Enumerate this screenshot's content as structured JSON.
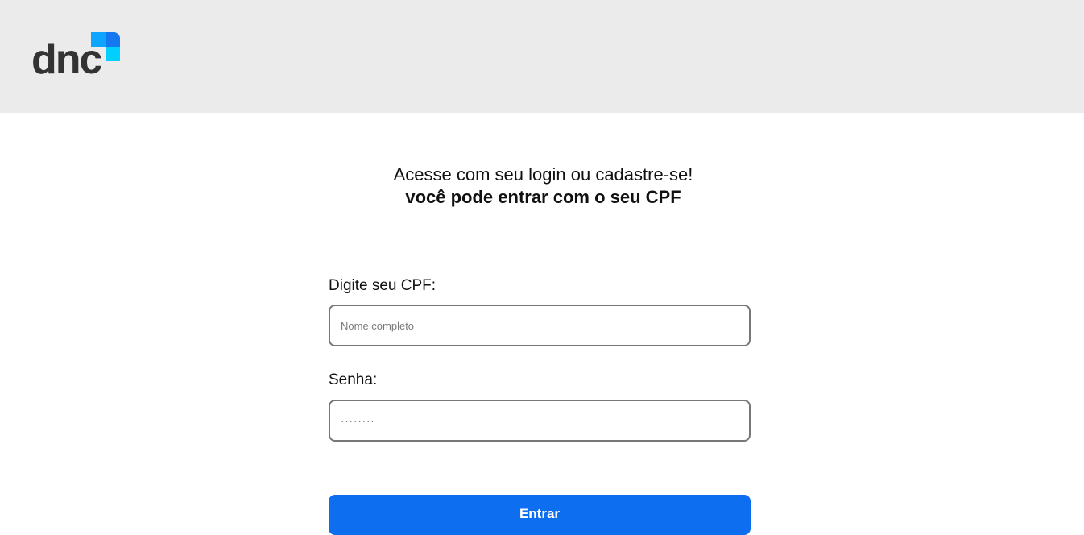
{
  "header": {
    "logo_text": "dnc",
    "logo_colors": {
      "top_right": "#1e90ff",
      "bottom_left": "#00d1ff"
    }
  },
  "login": {
    "title": "Acesse com seu login ou cadastre-se!",
    "subtitle": "você pode entrar com o seu CPF",
    "cpf_label": "Digite seu CPF:",
    "cpf_placeholder": "Nome completo",
    "cpf_value": "",
    "password_label": "Senha:",
    "password_placeholder": "········",
    "password_value": "",
    "submit_label": "Entrar"
  },
  "colors": {
    "header_bg": "#ebebeb",
    "primary_button": "#0d6ef0",
    "input_border": "#777777"
  }
}
